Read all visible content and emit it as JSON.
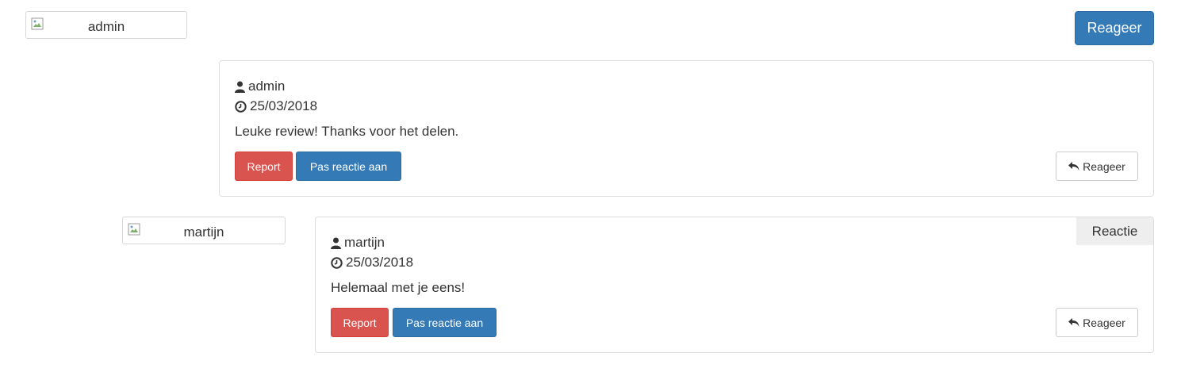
{
  "top": {
    "avatar_alt": "admin",
    "reply_button_label": "Reageer"
  },
  "comments": [
    {
      "username": "admin",
      "date": "25/03/2018",
      "text": "Leuke review! Thanks voor het delen.",
      "report_label": "Report",
      "edit_label": "Pas reactie aan",
      "reply_label": "Reageer",
      "avatar_alt": "admin"
    },
    {
      "username": "martijn",
      "date": "25/03/2018",
      "text": "Helemaal met je eens!",
      "report_label": "Report",
      "edit_label": "Pas reactie aan",
      "reply_label": "Reageer",
      "avatar_alt": "martijn",
      "badge": "Reactie"
    }
  ],
  "colors": {
    "primary": "#337ab7",
    "danger": "#d9534f",
    "border": "#dddddd",
    "badge_bg": "#eeeeee"
  },
  "icons": [
    "user-icon",
    "clock-icon",
    "reply-icon",
    "broken-image-icon"
  ]
}
